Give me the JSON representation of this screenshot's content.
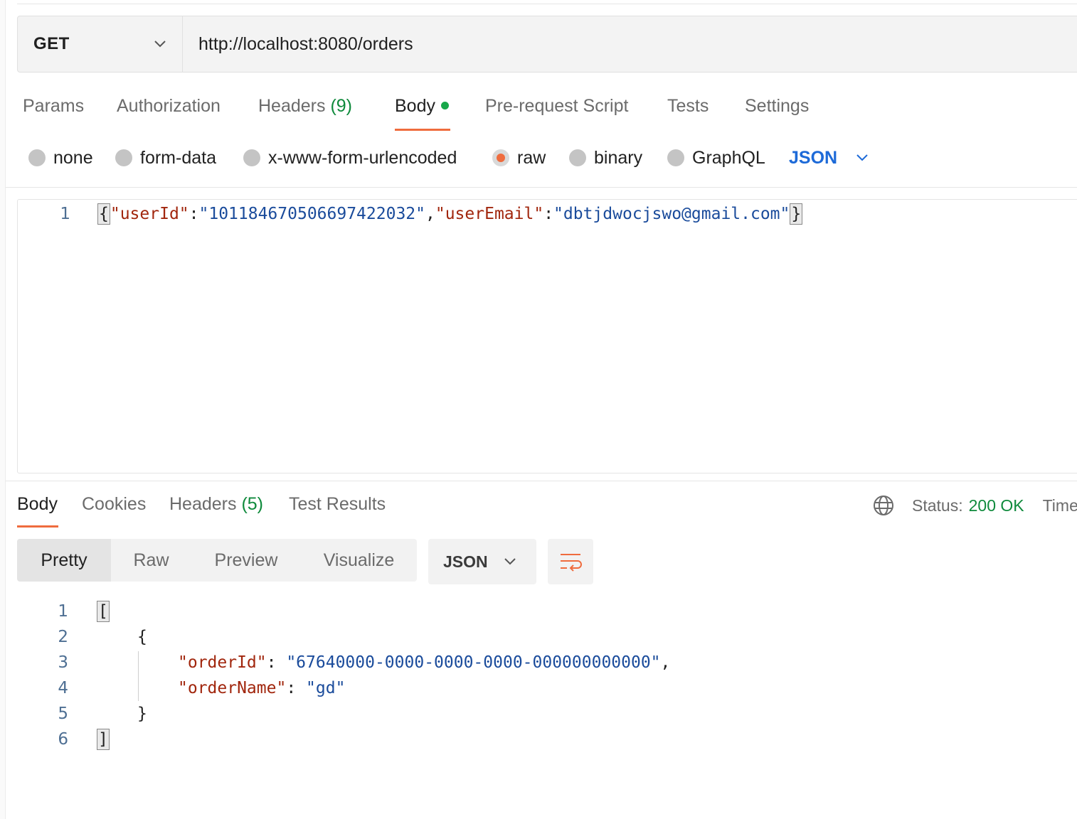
{
  "request": {
    "method": "GET",
    "url": "http://localhost:8080/orders",
    "tabs": [
      {
        "label": "Params"
      },
      {
        "label": "Authorization"
      },
      {
        "label": "Headers",
        "count": "(9)"
      },
      {
        "label": "Body",
        "active": true
      },
      {
        "label": "Pre-request Script"
      },
      {
        "label": "Tests"
      },
      {
        "label": "Settings"
      }
    ],
    "body_types": [
      "none",
      "form-data",
      "x-www-form-urlencoded",
      "raw",
      "binary",
      "GraphQL"
    ],
    "selected_body_type": "raw",
    "language": "JSON",
    "editor": {
      "line_number": "1",
      "open_brace": "{",
      "key1": "\"userId\"",
      "colon": ":",
      "val1": "\"101184670506697422032\"",
      "comma": ",",
      "key2": "\"userEmail\"",
      "val2": "\"dbtjdwocjswo@gmail.com\"",
      "close_brace": "}"
    }
  },
  "response": {
    "tabs": [
      {
        "label": "Body",
        "active": true
      },
      {
        "label": "Cookies"
      },
      {
        "label": "Headers",
        "count": "(5)"
      },
      {
        "label": "Test Results"
      }
    ],
    "status_label": "Status:",
    "status_value": "200 OK",
    "time_label": "Time",
    "view_modes": [
      "Pretty",
      "Raw",
      "Preview",
      "Visualize"
    ],
    "active_view": "Pretty",
    "format": "JSON",
    "lines": {
      "l1": {
        "n": "1",
        "text": "["
      },
      "l2": {
        "n": "2",
        "text": "{"
      },
      "l3": {
        "n": "3",
        "key": "\"orderId\"",
        "sep": ": ",
        "val": "\"67640000-0000-0000-0000-000000000000\"",
        "trail": ","
      },
      "l4": {
        "n": "4",
        "key": "\"orderName\"",
        "sep": ": ",
        "val": "\"gd\""
      },
      "l5": {
        "n": "5",
        "text": "}"
      },
      "l6": {
        "n": "6",
        "text": "]"
      }
    }
  },
  "colors": {
    "accent": "#ef6c3e",
    "link_blue": "#1d6ad8",
    "success_green": "#0f8a3c",
    "json_key": "#a1260d",
    "json_string": "#1a4b9b"
  }
}
